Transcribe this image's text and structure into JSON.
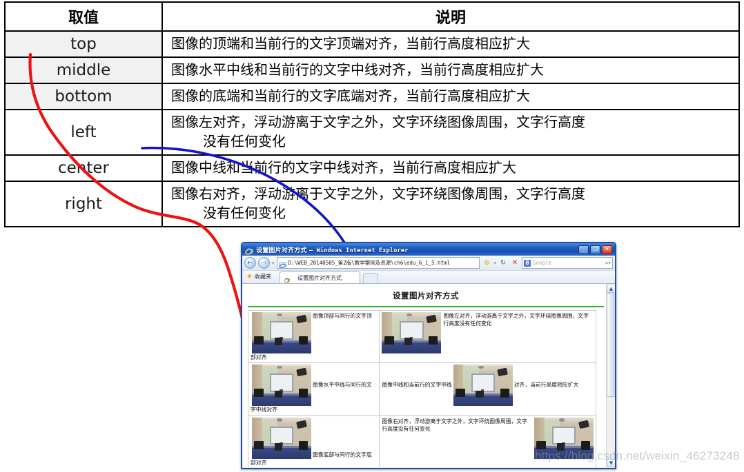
{
  "attr_table": {
    "headers": [
      "取值",
      "说明"
    ],
    "rows": [
      {
        "value": "top",
        "desc": "图像的顶端和当前行的文字顶端对齐，当前行高度相应扩大",
        "desc2": "",
        "shaded": true,
        "tall": false
      },
      {
        "value": "middle",
        "desc": "图像水平中线和当前行的文字中线对齐，当前行高度相应扩大",
        "desc2": "",
        "shaded": true,
        "tall": false
      },
      {
        "value": "bottom",
        "desc": "图像的底端和当前行的文字底端对齐，当前行高度相应扩大",
        "desc2": "",
        "shaded": true,
        "tall": false
      },
      {
        "value": "left",
        "desc": "图像左对齐，浮动游离于文字之外，文字环绕图像周围，文字行高度",
        "desc2": "没有任何变化",
        "shaded": false,
        "tall": true
      },
      {
        "value": "center",
        "desc": "图像中线和当前行的文字中线对齐，当前行高度相应扩大",
        "desc2": "",
        "shaded": false,
        "tall": false
      },
      {
        "value": "right",
        "desc": "图像右对齐，浮动游离于文字之外，文字环绕图像周围，文字行高度",
        "desc2": "没有任何变化",
        "shaded": false,
        "tall": true
      }
    ]
  },
  "browser": {
    "title": "设置图片对齐方式",
    "title_suffix": "– Windows Internet Explorer",
    "window_buttons": {
      "minimize": "_",
      "maximize": "❐",
      "close": "✕"
    },
    "nav": {
      "back": "←",
      "forward": "→",
      "history_caret": "▾"
    },
    "address": "D:\\WEB_20140505_第2版\\教学案例及资源\\ch6\\edu_6_1_5.html",
    "toolbar": {
      "compat": "⊕",
      "compat_caret": "▾",
      "refresh": "↻",
      "stop": "✕"
    },
    "search": {
      "engine_badge": "8",
      "placeholder": "Google",
      "go": "⌕",
      "caret": "▾"
    },
    "favorites_label": "收藏夹",
    "tab_label": "设置图片对齐方式",
    "scrollbar": {
      "up": "▲",
      "down": "▼"
    }
  },
  "page": {
    "title": "设置图片对齐方式",
    "cells": [
      {
        "id": "top",
        "text_before": "",
        "text_after": "图像顶部与同行的文字顶部对齐"
      },
      {
        "id": "left",
        "text_before": "",
        "text_after": "图像左对齐，浮动游离于文字之外，文字环绕图像周围，文字行高度没有任何变化"
      },
      {
        "id": "middle",
        "text_before": "",
        "text_after": "图像水平中线与同行的文字中线对齐"
      },
      {
        "id": "center",
        "text_before": "图像中线和当前行的文字中线",
        "text_after": "对齐，当前行高度相应扩大"
      },
      {
        "id": "bottom",
        "text_before": "",
        "text_after": "图像底部与同行的文字底部对齐"
      },
      {
        "id": "right",
        "text_before": "",
        "text_after": "图像右对齐，浮动游离于文字之外，文字环绕图像周围，文字行高度没有任何变化"
      }
    ]
  },
  "annotations": {
    "red_arrow_color": "#ee1111",
    "blue_arrow_color": "#1414cf"
  },
  "watermark": "https://blog.csdn.net/weixin_46273248"
}
